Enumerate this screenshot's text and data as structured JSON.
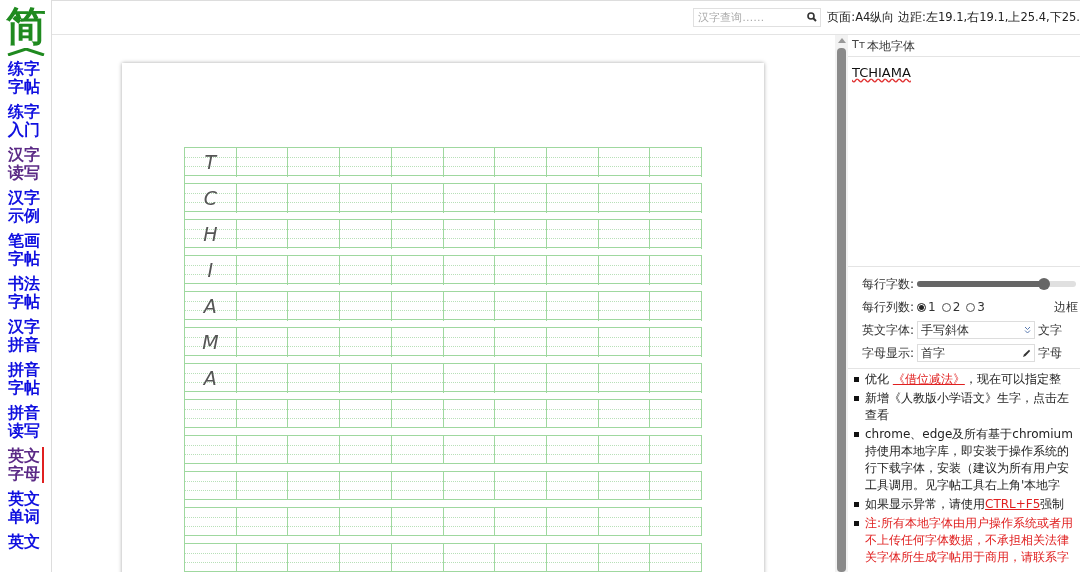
{
  "sidebar": {
    "logo": "简",
    "items": [
      {
        "label": "练字字帖",
        "visited": false,
        "selected": false
      },
      {
        "label": "练字入门",
        "visited": false,
        "selected": false
      },
      {
        "label": "汉字读写",
        "visited": true,
        "selected": false
      },
      {
        "label": "汉字示例",
        "visited": false,
        "selected": false
      },
      {
        "label": "笔画字帖",
        "visited": false,
        "selected": false
      },
      {
        "label": "书法字帖",
        "visited": false,
        "selected": false
      },
      {
        "label": "汉字拼音",
        "visited": false,
        "selected": false
      },
      {
        "label": "拼音字帖",
        "visited": false,
        "selected": false
      },
      {
        "label": "拼音读写",
        "visited": false,
        "selected": false
      },
      {
        "label": "英文字母",
        "visited": true,
        "selected": true
      },
      {
        "label": "英文单词",
        "visited": false,
        "selected": false
      },
      {
        "label": "英文",
        "visited": false,
        "selected": false
      }
    ]
  },
  "search": {
    "placeholder": "汉字查询……"
  },
  "page_info": "页面:A4纵向 边距:左19.1,右19.1,上25.4,下25.",
  "sheet": {
    "letters": [
      "T",
      "C",
      "H",
      "I",
      "A",
      "M",
      "A"
    ]
  },
  "font_panel": {
    "heading": "本地字体",
    "heading_icon": "Tт",
    "text": "TCHIAMA"
  },
  "settings": {
    "chars_per_row": {
      "label": "每行字数:",
      "level": 0.8
    },
    "columns": {
      "label": "每行列数:",
      "options": [
        {
          "label": "1",
          "selected": true
        },
        {
          "label": "2",
          "selected": false
        },
        {
          "label": "3",
          "selected": false
        }
      ]
    },
    "font": {
      "label": "英文字体:",
      "value": "手写斜体"
    },
    "letters": {
      "label": "字母显示:",
      "value": "首字"
    },
    "right_labels": [
      "边框",
      "文字",
      "字母"
    ]
  },
  "notes": [
    {
      "kind": "normal",
      "lines": [
        "优化 **《借位减法》**，现在可以指定整"
      ]
    },
    {
      "kind": "normal",
      "lines": [
        "新增《人教版小学语文》生字，点击左",
        "查看"
      ]
    },
    {
      "kind": "normal",
      "lines": [
        "chrome、edge及所有基于chromium",
        "持使用本地字库，即安装于操作系统的",
        "行下载字体，安装（建议为所有用户安",
        "工具调用。见字帖工具右上角'本地字"
      ]
    },
    {
      "kind": "normal",
      "lines": [
        "如果显示异常，请使用**CTRL+F5**强制"
      ]
    },
    {
      "kind": "warning",
      "lines": [
        "注:所有本地字体由用户操作系统或者用",
        "不上传任何字体数据，不承担相关法律",
        "关字体所生成字帖用于商用，请联系字"
      ]
    }
  ]
}
